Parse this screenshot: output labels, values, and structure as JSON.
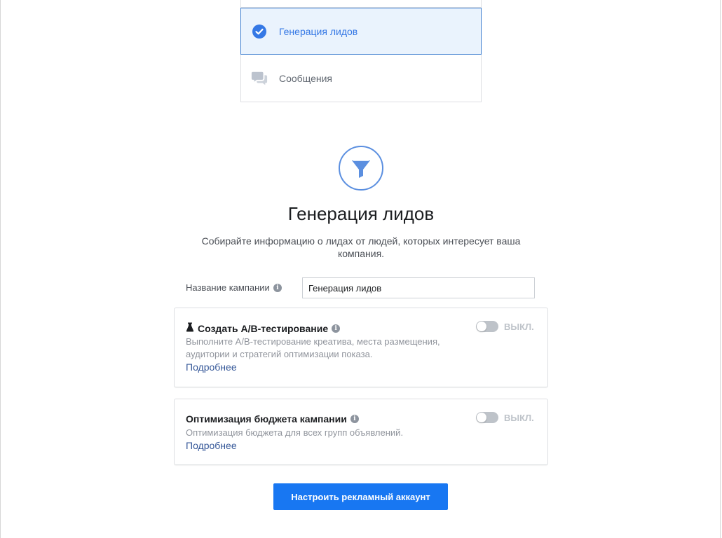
{
  "objectives": [
    {
      "label": "Генерация лидов",
      "icon": "check-circle-icon",
      "selected": true
    },
    {
      "label": "Сообщения",
      "icon": "chat-bubbles-icon",
      "selected": false
    }
  ],
  "hero": {
    "icon": "funnel-icon",
    "title": "Генерация лидов",
    "description": "Собирайте информацию о лидах от людей, которых интересует ваша компания."
  },
  "campaign_name": {
    "label": "Название кампании",
    "value": "Генерация лидов"
  },
  "ab_test": {
    "icon": "flask-icon",
    "title": "Создать A/B-тестирование",
    "description": "Выполните A/B-тестирование креатива, места размещения, аудитории и стратегий оптимизации показа.",
    "link": "Подробнее",
    "toggle_label": "ВЫКЛ.",
    "enabled": false
  },
  "budget_optimization": {
    "title": "Оптимизация бюджета кампании",
    "description": "Оптимизация бюджета для всех групп объявлений.",
    "link": "Подробнее",
    "toggle_label": "ВЫКЛ.",
    "enabled": false
  },
  "submit_button": "Настроить рекламный аккаунт",
  "colors": {
    "accent": "#1877f2",
    "selected_bg": "#eaf3fd",
    "selected_border": "#4080d0",
    "link": "#365899",
    "toggle_off": "#bec3c9"
  }
}
